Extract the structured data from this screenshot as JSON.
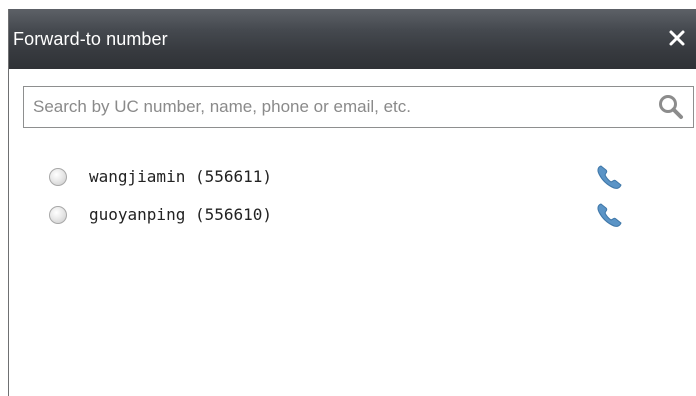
{
  "dialog": {
    "title": "Forward-to number",
    "close_icon": "close-icon"
  },
  "search": {
    "placeholder": "Search by UC number, name, phone or email, etc.",
    "value": "",
    "icon": "search-icon"
  },
  "contacts": [
    {
      "name": "wangjiamin",
      "number": "(556611)",
      "label": "wangjiamin (556611)",
      "selected": false,
      "icon": "phone-icon"
    },
    {
      "name": "guoyanping",
      "number": "(556610)",
      "label": "guoyanping (556610)",
      "selected": false,
      "icon": "phone-icon"
    }
  ],
  "colors": {
    "titlebar": "#3a3d42",
    "phone_icon": "#4f86b8",
    "border": "#8e8f8f"
  }
}
